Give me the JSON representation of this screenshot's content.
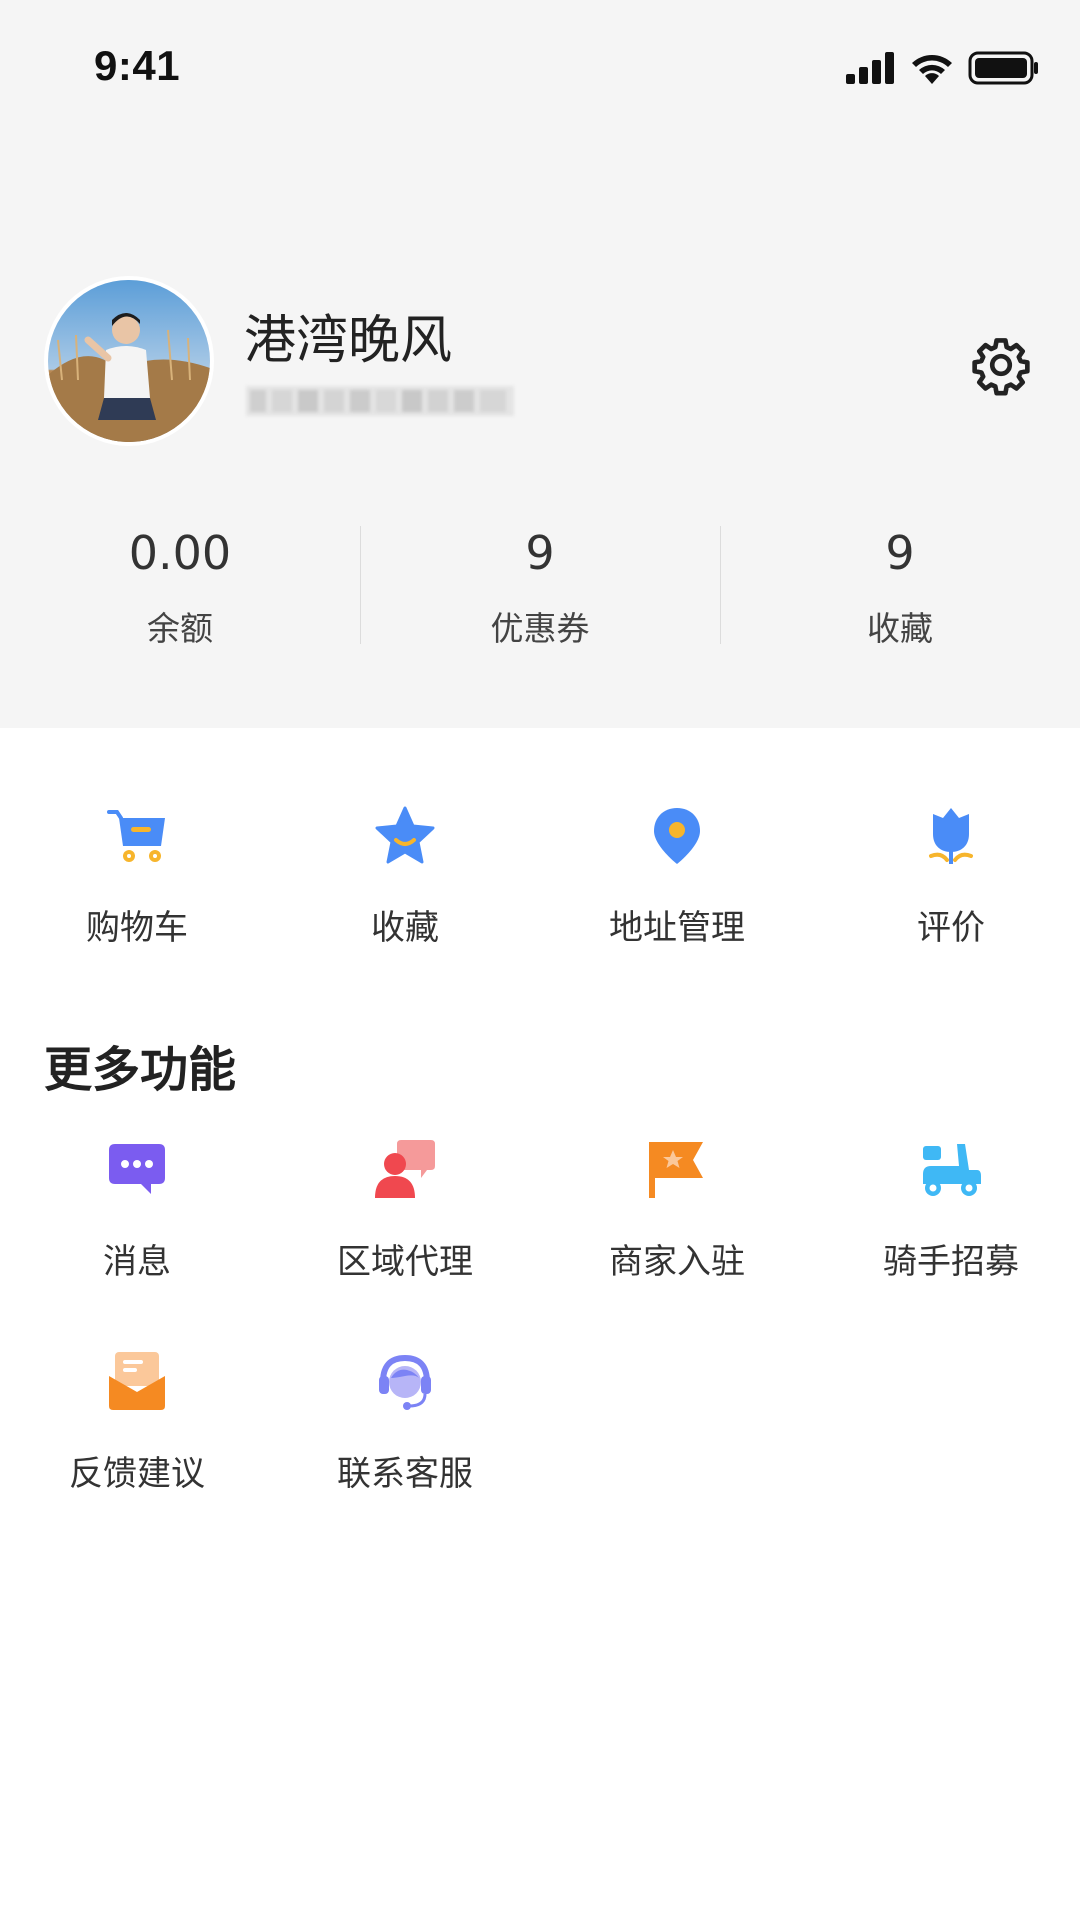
{
  "status_bar": {
    "time": "9:41"
  },
  "profile": {
    "name": "港湾晚风",
    "avatar": "avatar-photo"
  },
  "stats": [
    {
      "value": "0.00",
      "label": "余额"
    },
    {
      "value": "9",
      "label": "优惠券"
    },
    {
      "value": "9",
      "label": "收藏"
    }
  ],
  "quick_actions": [
    {
      "label": "购物车",
      "icon": "shopping-cart-icon"
    },
    {
      "label": "收藏",
      "icon": "star-icon"
    },
    {
      "label": "地址管理",
      "icon": "location-pin-icon"
    },
    {
      "label": "评价",
      "icon": "tulip-icon"
    }
  ],
  "more": {
    "title": "更多功能",
    "items": [
      {
        "label": "消息",
        "icon": "chat-bubble-icon"
      },
      {
        "label": "区域代理",
        "icon": "agent-chat-icon"
      },
      {
        "label": "商家入驻",
        "icon": "flag-icon"
      },
      {
        "label": "骑手招募",
        "icon": "scooter-icon"
      },
      {
        "label": "反馈建议",
        "icon": "envelope-icon"
      },
      {
        "label": "联系客服",
        "icon": "headset-icon"
      }
    ]
  },
  "colors": {
    "header_bg": "#f5f5f5",
    "blue": "#4a8cf7",
    "yellow": "#f7b52c",
    "purple": "#7b5cf0",
    "red": "#f0484f",
    "orange": "#f58a22",
    "sky": "#3fb8f5"
  }
}
